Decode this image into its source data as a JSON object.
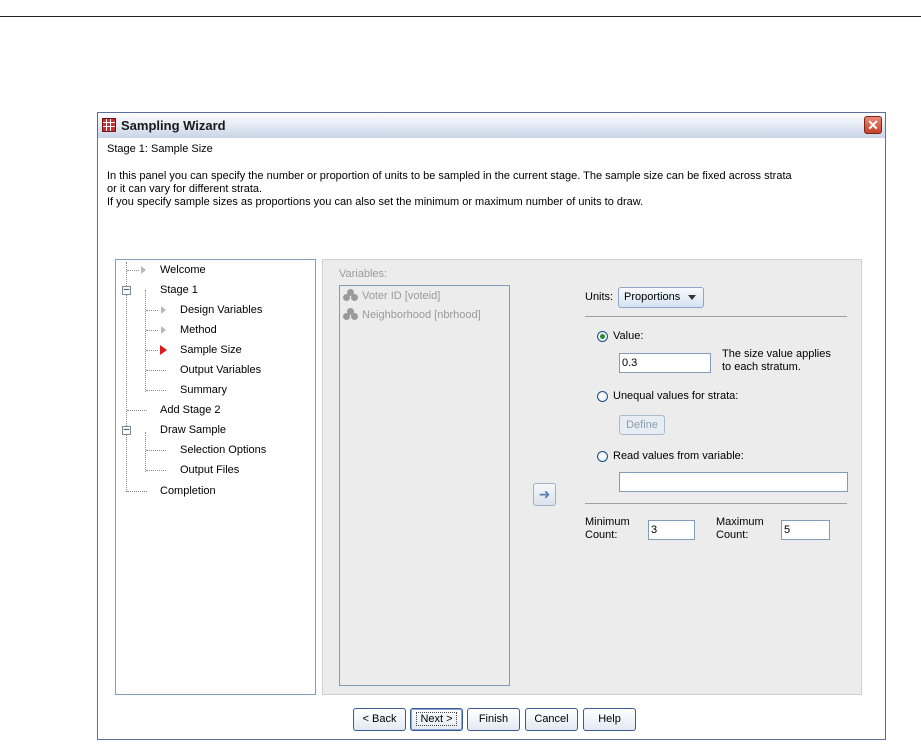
{
  "window": {
    "title": "Sampling Wizard"
  },
  "header": {
    "stage_label": "Stage 1: Sample Size",
    "description_lines": [
      "In this panel you can specify the number or proportion of units to be sampled in the current stage. The sample size can be fixed across strata",
      "or it can vary for different strata.",
      "If you specify sample sizes as proportions you can also set the minimum or maximum number of units to draw."
    ]
  },
  "tree": {
    "items": [
      {
        "label": "Welcome"
      },
      {
        "label": "Stage 1"
      },
      {
        "label": "Design Variables"
      },
      {
        "label": "Method"
      },
      {
        "label": "Sample Size"
      },
      {
        "label": "Output Variables"
      },
      {
        "label": "Summary"
      },
      {
        "label": "Add Stage 2"
      },
      {
        "label": "Draw Sample"
      },
      {
        "label": "Selection Options"
      },
      {
        "label": "Output Files"
      },
      {
        "label": "Completion"
      }
    ],
    "active_item": "Sample Size"
  },
  "variables": {
    "label": "Variables:",
    "items": [
      {
        "label": "Voter ID [voteid]"
      },
      {
        "label": "Neighborhood [nbrhood]"
      }
    ]
  },
  "units": {
    "label": "Units:",
    "selected": "Proportions"
  },
  "value_option": {
    "label": "Value:",
    "selected": true,
    "value": "0.3",
    "help_line1": "The size value applies",
    "help_line2": "to each stratum."
  },
  "unequal_option": {
    "label": "Unequal values for strata:",
    "define_label": "Define"
  },
  "read_option": {
    "label": "Read values from variable:",
    "value": ""
  },
  "min_count": {
    "label_line1": "Minimum",
    "label_line2": "Count:",
    "value": "3"
  },
  "max_count": {
    "label_line1": "Maximum",
    "label_line2": "Count:",
    "value": "5"
  },
  "buttons": {
    "back": "< Back",
    "next": "Next >",
    "finish": "Finish",
    "cancel": "Cancel",
    "help": "Help"
  },
  "colors": {
    "active_marker": "#e01a1a",
    "title_bar": "#dde6f2",
    "close_button": "#c6402a"
  }
}
